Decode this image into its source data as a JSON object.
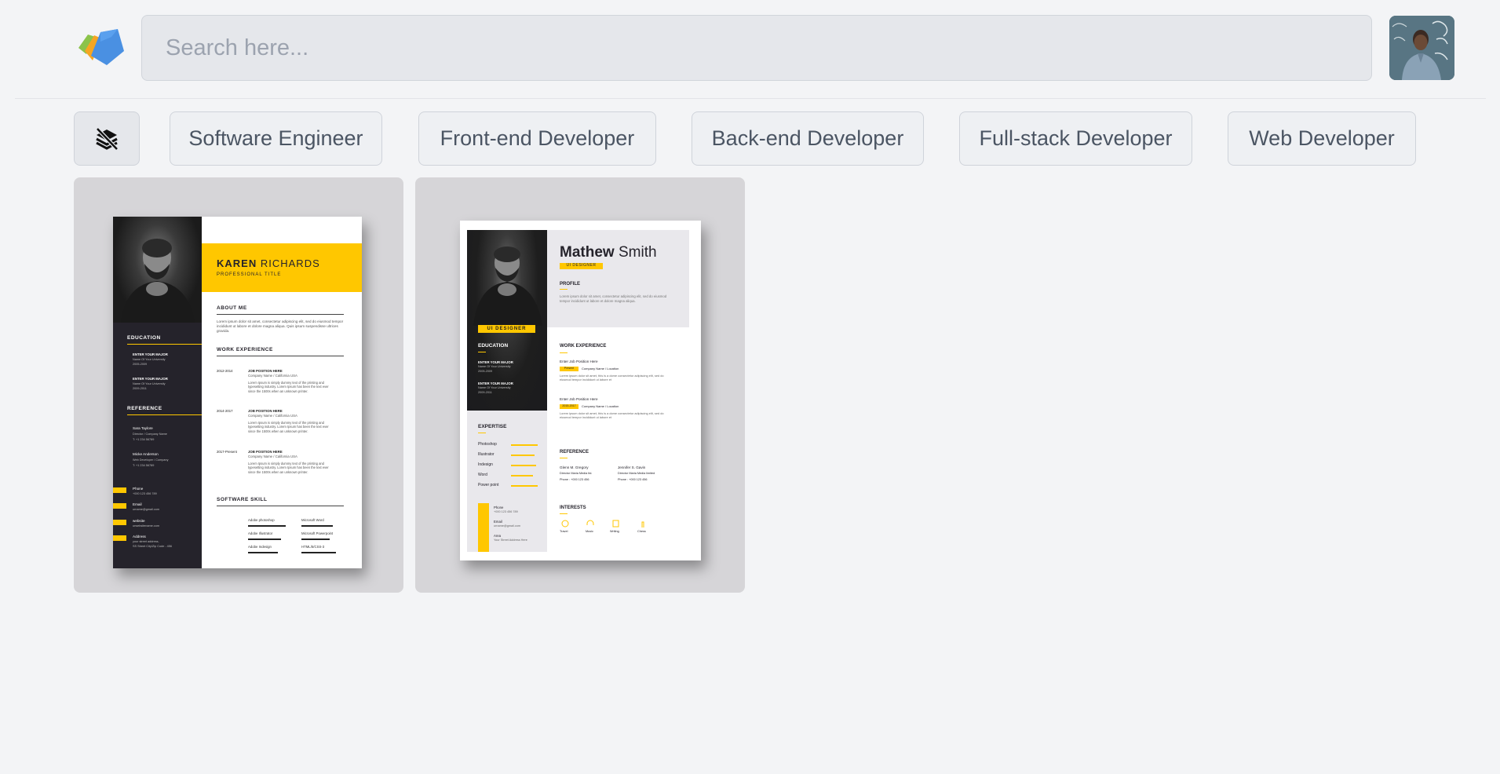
{
  "header": {
    "search_placeholder": "Search here..."
  },
  "filters": {
    "icon": "layers-off-icon",
    "chips": [
      "Software Engineer",
      "Front-end Developer",
      "Back-end Developer",
      "Full-stack Developer",
      "Web Developer"
    ]
  },
  "colors": {
    "accent": "#ffc700",
    "dark": "#25232b"
  },
  "templates": [
    {
      "first_name": "KAREN",
      "last_name": "RICHARDS",
      "title": "PROFESSIONAL TITLE",
      "sections": {
        "about": "ABOUT ME",
        "work": "WORK EXPERIENCE",
        "skill": "SOFTWARE SKILL",
        "education": "EDUCATION",
        "reference": "REFERENCE"
      },
      "about_text": "Lorem ipsum dolor sit amet, consectetur adipiscing elit, sed do eiusmod tempor incididunt ut labore et dolore magna aliqua. Quis ipsum suspendisse ultrices gravida.",
      "education": [
        {
          "major": "ENTER YOUR MAJOR",
          "school": "Name Of Your University",
          "years": "2005-2009"
        },
        {
          "major": "ENTER YOUR MAJOR",
          "school": "Name Of Your University",
          "years": "2009-2011"
        }
      ],
      "references": [
        {
          "name": "Sara Taylore",
          "role": "Director / Company Name",
          "phone": "T: +1 234 56789"
        },
        {
          "name": "Micke Anderson",
          "role": "Web Developer / Company",
          "phone": "T: +1 234 56789"
        }
      ],
      "contacts": [
        {
          "label": "Phone",
          "value": "+000 123 456 789"
        },
        {
          "label": "Email",
          "value": "urname@gmail.com"
        },
        {
          "label": "website",
          "value": "urwebsitename.com"
        },
        {
          "label": "Address",
          "value": "your street address,"
        },
        {
          "label": "",
          "value": "SS Street City/Zip Code - 456"
        }
      ],
      "jobs": [
        {
          "years": "2012-2014",
          "title": "JOB POSITION HERE",
          "company": "Company Name / California USA",
          "desc": "Lorem Ipsum is simply dummy text of the printing and typesetting industry. Lorem Ipsum has been the text ever since the 1500s when an unknown printer."
        },
        {
          "years": "2014-2017",
          "title": "JOB POSITION HERE",
          "company": "Company Name / California USA",
          "desc": "Lorem Ipsum is simply dummy text of the printing and typesetting industry. Lorem Ipsum has been the text ever since the 1500s when an unknown printer."
        },
        {
          "years": "2017-Present",
          "title": "JOB POSITION HERE",
          "company": "Company Name / California USA",
          "desc": "Lorem Ipsum is simply dummy text of the printing and typesetting industry. Lorem Ipsum has been the text ever since the 1500s when an unknown printer."
        }
      ],
      "skills": [
        "Adobe photoshop",
        "Microsoft Word",
        "Adobe Illustrator",
        "Microsoft Powerpoint",
        "Adobe Indesign",
        "HTML/5/CSS-3"
      ]
    },
    {
      "first_name": "Mathew",
      "last_name": "Smith",
      "badge": "UI DESIGNER",
      "side_badge": "UI DESIGNER",
      "sections": {
        "profile": "PROFILE",
        "work": "WORK EXPERIENCE",
        "reference": "REFERENCE",
        "interests": "INTERESTS",
        "education": "EDUCATION",
        "expertise": "EXPERTISE"
      },
      "profile_text": "Lorem ipsum dolor sit amet, consectetur adipiscing elit, sed do eiusmod tempor incididunt ut labore et dolore magna aliqua.",
      "education": [
        {
          "major": "ENTER YOUR MAJOR",
          "school": "Name Of Your University",
          "years": "2005-2009"
        },
        {
          "major": "ENTER YOUR MAJOR",
          "school": "Name Of Your University",
          "years": "2009-2011"
        }
      ],
      "expertise": [
        "Photoshop",
        "Illustrator",
        "Indesign",
        "Word",
        "Power point"
      ],
      "contacts": [
        {
          "label": "Phone",
          "value": "+000 123 456 789"
        },
        {
          "label": "Email",
          "value": "urname@gmail.com"
        },
        {
          "label": "Area",
          "value": "Your Street Address Here"
        }
      ],
      "jobs": [
        {
          "title": "Enter Job Position Here",
          "years": "Present",
          "company": "Company Name / Location",
          "desc": "Lorem ipsum dolor sit amet, this is a dome consectetur adipiscing elit, sed do eiusmod tempor incididunt ut labore et"
        },
        {
          "title": "Enter Job Position Here",
          "years": "2015-2017",
          "company": "Company Name / Location",
          "desc": "Lorem ipsum dolor sit amet, this is a dome consectetur adipiscing elit, sed do eiusmod tempor incididunt ut labore et"
        }
      ],
      "references": [
        {
          "name": "Glenn M. Gregory",
          "role": "Director Maria Media ltd.",
          "phone": "Phone : +000 123 456"
        },
        {
          "name": "Jennifer S. Gavin",
          "role": "Director Maria Media limited",
          "phone": "Phone : +000 123 456"
        }
      ],
      "interests": [
        "Travel",
        "Music",
        "Writing",
        "Chess"
      ]
    }
  ]
}
